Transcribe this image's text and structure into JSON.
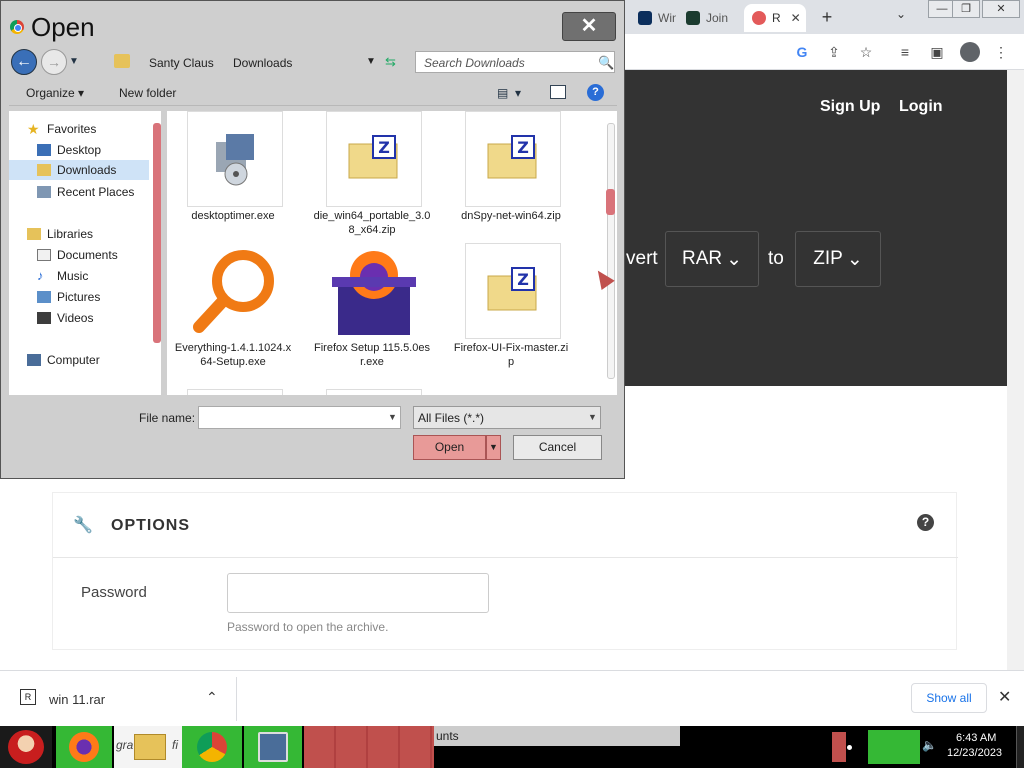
{
  "browser": {
    "tabs": [
      {
        "label": "Winc",
        "color": "#0b2e5c"
      },
      {
        "label": "Join",
        "color": "#1b3b2f"
      },
      {
        "label": "R",
        "color": "#e35a5a"
      }
    ],
    "new_tab": "+",
    "tab_search": "⌄",
    "window_controls": [
      "—",
      "❐",
      "✕"
    ],
    "toolbar_icons": [
      "G",
      "⇪",
      "☆",
      "≡",
      "▣",
      "⋮"
    ]
  },
  "site": {
    "signup": "Sign Up",
    "login": "Login",
    "convert_word": "vert",
    "from_format": "RAR",
    "to_word": "to",
    "to_format": "ZIP",
    "options_title": "OPTIONS",
    "password_label": "Password",
    "password_hint": "Password to open the archive."
  },
  "downloads": {
    "file": "win 11.rar",
    "show_all": "Show all"
  },
  "dialog": {
    "title": "Open",
    "breadcrumb": [
      "Santy Claus",
      "Downloads"
    ],
    "search_placeholder": "Search Downloads",
    "organize": "Organize",
    "new_folder": "New folder",
    "nav": {
      "favorites": "Favorites",
      "desktop": "Desktop",
      "downloads": "Downloads",
      "recent": "Recent Places",
      "libraries": "Libraries",
      "documents": "Documents",
      "music": "Music",
      "pictures": "Pictures",
      "videos": "Videos",
      "computer": "Computer"
    },
    "files": [
      {
        "name": "desktoptimer.exe",
        "icon": "installer-icon"
      },
      {
        "name": "die_win64_portable_3.08_x64.zip",
        "icon": "zip-folder-icon"
      },
      {
        "name": "dnSpy-net-win64.zip",
        "icon": "zip-folder-icon"
      },
      {
        "name": "Everything-1.4.1.1024.x64-Setup.exe",
        "icon": "magnifier-icon"
      },
      {
        "name": "Firefox Setup 115.5.0esr.exe",
        "icon": "firefox-box-icon"
      },
      {
        "name": "Firefox-UI-Fix-master.zip",
        "icon": "zip-folder-icon"
      }
    ],
    "file_name_label": "File name:",
    "file_name_value": "",
    "filter": "All Files (*.*)",
    "open": "Open",
    "cancel": "Cancel"
  },
  "taskbar": {
    "partial_label_1": "gra",
    "partial_label_2": "fi",
    "partial_label_3": "unts",
    "time": "6:43 AM",
    "date": "12/23/2023"
  },
  "colors": {
    "hero_bg": "#333333",
    "accent_red": "#d9737a",
    "taskbar_green": "#35b835"
  }
}
